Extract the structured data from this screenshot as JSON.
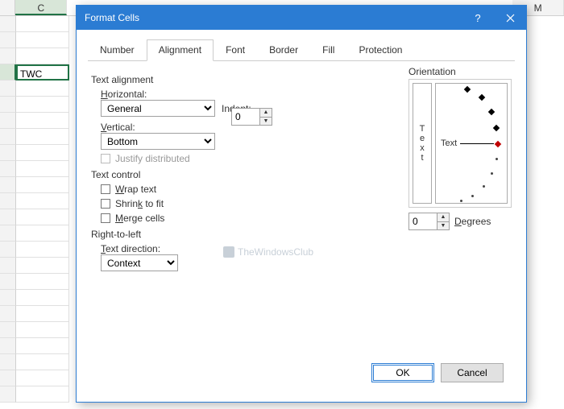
{
  "spreadsheet": {
    "visible_columns": [
      "C",
      "M"
    ],
    "active_cell_value": "TWC"
  },
  "dialog": {
    "title": "Format Cells",
    "tabs": [
      "Number",
      "Alignment",
      "Font",
      "Border",
      "Fill",
      "Protection"
    ],
    "active_tab": "Alignment",
    "sections": {
      "text_alignment": {
        "label": "Text alignment",
        "horizontal_label": "Horizontal:",
        "horizontal_value": "General",
        "indent_label": "Indent:",
        "indent_value": "0",
        "vertical_label": "Vertical:",
        "vertical_value": "Bottom",
        "justify_label": "Justify distributed"
      },
      "text_control": {
        "label": "Text control",
        "wrap_label": "Wrap text",
        "shrink_label": "Shrink to fit",
        "merge_label": "Merge cells"
      },
      "rtl": {
        "label": "Right-to-left",
        "direction_label": "Text direction:",
        "direction_value": "Context"
      },
      "orientation": {
        "label": "Orientation",
        "vertical_text": "Text",
        "horizontal_text": "Text",
        "degrees_value": "0",
        "degrees_label": "Degrees"
      }
    },
    "buttons": {
      "ok": "OK",
      "cancel": "Cancel"
    }
  },
  "watermark": "TheWindowsClub"
}
